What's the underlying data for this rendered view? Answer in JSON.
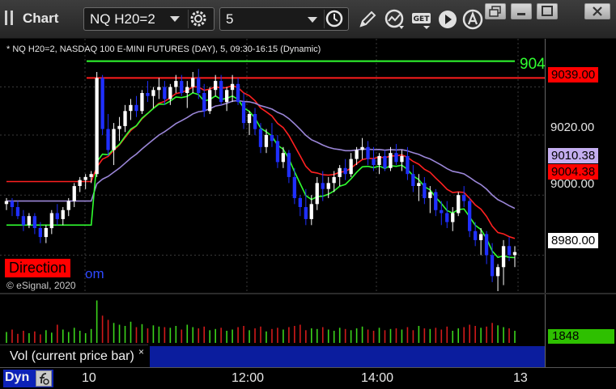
{
  "app": {
    "title": "Chart"
  },
  "toolbar": {
    "symbol_value": "NQ H20=2",
    "interval_value": "5",
    "icons": [
      "settings-icon",
      "clock-icon",
      "pencil-icon",
      "indicator-icon",
      "get-icon",
      "play-icon",
      "alert-icon"
    ],
    "get_label": "GET"
  },
  "chart": {
    "header": "* NQ H20=2, NASDAQ 100 E-MINI FUTURES (DAY), 5, 09:30-16:15 (Dynamic)",
    "direction_label": "Direction",
    "url_fragment": "om",
    "copyright": "© eSignal, 2020",
    "green_level_label": "904",
    "price_ticks": [
      "9020.00",
      "9000.00"
    ],
    "price_tags": [
      {
        "label": "9039.00",
        "bg": "#ff0000",
        "fg": "#000000"
      },
      {
        "label": "9010.38",
        "bg": "#c4aef0",
        "fg": "#000000"
      },
      {
        "label": "9004.38",
        "bg": "#ff0000",
        "fg": "#000000"
      },
      {
        "label": "8980.00",
        "bg": "#ffffff",
        "fg": "#000000"
      }
    ]
  },
  "volume": {
    "label": "Vol (current price bar)",
    "close": "×",
    "tag": "1848"
  },
  "time_axis": {
    "labels": [
      "10",
      "12:00",
      "14:00",
      "13"
    ],
    "dyn_label": "Dyn"
  },
  "colors": {
    "up_candle": "#ffffff",
    "down_candle": "#1f2fff",
    "resistance": "#ff1c1c",
    "green_line": "#30ff30",
    "purple_line": "#9b86d8",
    "red_ma": "#ff2020",
    "vol_up": "#3bd41b",
    "vol_down": "#d11a1a"
  },
  "chart_data": {
    "type": "candlestick",
    "interval": "5",
    "y_unit": "price",
    "ylim": [
      8968,
      9048
    ],
    "levels": [
      {
        "name": "green",
        "value": 9044.6
      },
      {
        "name": "red",
        "value": 9039.0
      }
    ],
    "candles": [
      [
        8997,
        8999,
        8995,
        8998
      ],
      [
        8998,
        8999,
        8993,
        8996
      ],
      [
        8996,
        8998,
        8992,
        8993
      ],
      [
        8993,
        8995,
        8988,
        8990
      ],
      [
        8990,
        8994,
        8989,
        8993
      ],
      [
        8993,
        8994,
        8987,
        8989
      ],
      [
        8989,
        8991,
        8984,
        8986
      ],
      [
        8986,
        8990,
        8984,
        8989
      ],
      [
        8989,
        8995,
        8987,
        8994
      ],
      [
        8994,
        8997,
        8990,
        8992
      ],
      [
        8992,
        8996,
        8990,
        8995
      ],
      [
        8995,
        8999,
        8993,
        8998
      ],
      [
        8998,
        9004,
        8996,
        9003
      ],
      [
        9003,
        9006,
        9001,
        9005
      ],
      [
        9005,
        9007,
        9002,
        9006
      ],
      [
        9006,
        9008,
        9004,
        9007
      ],
      [
        9007,
        9041,
        9006,
        9039
      ],
      [
        9039,
        9040,
        9020,
        9022
      ],
      [
        9022,
        9027,
        9013,
        9015
      ],
      [
        9015,
        9024,
        9010,
        9022
      ],
      [
        9022,
        9026,
        9018,
        9023
      ],
      [
        9023,
        9030,
        9021,
        9028
      ],
      [
        9028,
        9032,
        9025,
        9030
      ],
      [
        9030,
        9033,
        9026,
        9028
      ],
      [
        9028,
        9035,
        9027,
        9034
      ],
      [
        9034,
        9038,
        9031,
        9033
      ],
      [
        9033,
        9036,
        9029,
        9035
      ],
      [
        9035,
        9039,
        9032,
        9036
      ],
      [
        9036,
        9038,
        9030,
        9032
      ],
      [
        9032,
        9037,
        9030,
        9036
      ],
      [
        9036,
        9040,
        9034,
        9038
      ],
      [
        9038,
        9040,
        9033,
        9034
      ],
      [
        9034,
        9038,
        9029,
        9036
      ],
      [
        9036,
        9041,
        9034,
        9039
      ],
      [
        9039,
        9042,
        9032,
        9034
      ],
      [
        9034,
        9037,
        9026,
        9028
      ],
      [
        9028,
        9036,
        9027,
        9035
      ],
      [
        9035,
        9040,
        9033,
        9038
      ],
      [
        9038,
        9040,
        9030,
        9031
      ],
      [
        9031,
        9036,
        9028,
        9035
      ],
      [
        9035,
        9040,
        9031,
        9037
      ],
      [
        9037,
        9039,
        9030,
        9031
      ],
      [
        9031,
        9034,
        9022,
        9024
      ],
      [
        9024,
        9028,
        9020,
        9027
      ],
      [
        9027,
        9029,
        9020,
        9022
      ],
      [
        9022,
        9024,
        9014,
        9016
      ],
      [
        9016,
        9022,
        9014,
        9020
      ],
      [
        9020,
        9024,
        9016,
        9018
      ],
      [
        9018,
        9020,
        9009,
        9011
      ],
      [
        9011,
        9016,
        9009,
        9014
      ],
      [
        9014,
        9015,
        9004,
        9006
      ],
      [
        9006,
        9009,
        8997,
        8999
      ],
      [
        8999,
        9000,
        8993,
        8996
      ],
      [
        8996,
        9002,
        8990,
        8992
      ],
      [
        8992,
        9000,
        8990,
        8997
      ],
      [
        8997,
        9006,
        8995,
        9004
      ],
      [
        9004,
        9008,
        8998,
        9002
      ],
      [
        9002,
        9006,
        8999,
        9004
      ],
      [
        9004,
        9008,
        9001,
        9006
      ],
      [
        9006,
        9010,
        9003,
        9009
      ],
      [
        9009,
        9012,
        9005,
        9007
      ],
      [
        9007,
        9014,
        9006,
        9012
      ],
      [
        9012,
        9016,
        9010,
        9015
      ],
      [
        9015,
        9019,
        9012,
        9016
      ],
      [
        9016,
        9018,
        9010,
        9012
      ],
      [
        9012,
        9016,
        9008,
        9010
      ],
      [
        9010,
        9014,
        9007,
        9013
      ],
      [
        9013,
        9015,
        9008,
        9009
      ],
      [
        9009,
        9016,
        9008,
        9014
      ],
      [
        9014,
        9017,
        9010,
        9011
      ],
      [
        9011,
        9015,
        9008,
        9013
      ],
      [
        9013,
        9016,
        9005,
        9007
      ],
      [
        9007,
        9010,
        9001,
        9003
      ],
      [
        9003,
        9007,
        8998,
        9004
      ],
      [
        9004,
        9006,
        8997,
        8999
      ],
      [
        8999,
        9003,
        8994,
        9001
      ],
      [
        9001,
        9002,
        8993,
        8995
      ],
      [
        8995,
        8998,
        8990,
        8994
      ],
      [
        8994,
        8998,
        8989,
        8991
      ],
      [
        8991,
        8996,
        8988,
        8994
      ],
      [
        8994,
        9001,
        8993,
        9000
      ],
      [
        9000,
        9003,
        8996,
        8998
      ],
      [
        8998,
        8999,
        8986,
        8988
      ],
      [
        8988,
        8991,
        8983,
        8985
      ],
      [
        8985,
        8989,
        8980,
        8987
      ],
      [
        8987,
        8988,
        8977,
        8980
      ],
      [
        8980,
        8984,
        8971,
        8973
      ],
      [
        8973,
        8977,
        8968,
        8976
      ],
      [
        8976,
        8985,
        8970,
        8983
      ],
      [
        8983,
        8986,
        8978,
        8980
      ],
      [
        8980,
        8983,
        8976,
        8981
      ]
    ],
    "volume": [
      18,
      22,
      15,
      20,
      16,
      19,
      14,
      21,
      17,
      30,
      22,
      18,
      25,
      20,
      16,
      23,
      70,
      45,
      38,
      33,
      30,
      28,
      35,
      26,
      31,
      24,
      29,
      27,
      26,
      25,
      28,
      22,
      30,
      26,
      24,
      27,
      21,
      23,
      25,
      20,
      22,
      26,
      28,
      21,
      24,
      27,
      19,
      23,
      25,
      22,
      26,
      28,
      30,
      21,
      24,
      23,
      26,
      22,
      20,
      25,
      23,
      21,
      24,
      27,
      22,
      20,
      25,
      21,
      23,
      24,
      22,
      26,
      21,
      28,
      24,
      23,
      25,
      22,
      27,
      20,
      24,
      26,
      30,
      28,
      25,
      27,
      33,
      29,
      26,
      24,
      20
    ],
    "time_labels": [
      "10",
      "12:00",
      "14:00",
      "13"
    ]
  }
}
